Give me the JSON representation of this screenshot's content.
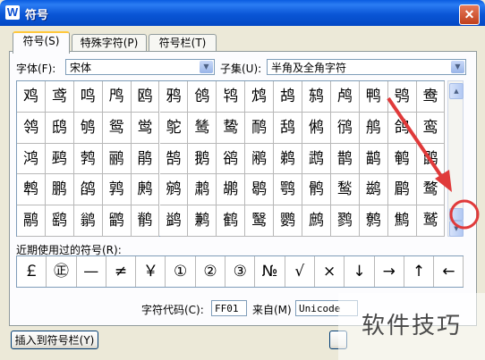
{
  "window": {
    "title": "符号",
    "close_glyph": "✕",
    "app_glyph": "W"
  },
  "tabs": [
    {
      "label": "符号(S)",
      "active": true
    },
    {
      "label": "特殊字符(P)",
      "active": false
    },
    {
      "label": "符号栏(T)",
      "active": false
    }
  ],
  "font": {
    "label": "字体(F):",
    "value": "宋体"
  },
  "subset": {
    "label": "子集(U):",
    "value": "半角及全角字符"
  },
  "grid_chars": [
    [
      "鸡",
      "鸢",
      "鸣",
      "鸤",
      "鸥",
      "鸦",
      "鸧",
      "鸨",
      "鸩",
      "鸪",
      "鸫",
      "鸬",
      "鸭",
      "鸮",
      "鸯"
    ],
    [
      "鸰",
      "鸱",
      "鸲",
      "鸳",
      "鸴",
      "鸵",
      "鸶",
      "鸷",
      "鸸",
      "鸹",
      "鸺",
      "鸻",
      "鸼",
      "鸽",
      "鸾"
    ],
    [
      "鸿",
      "鹀",
      "鹁",
      "鹂",
      "鹃",
      "鹄",
      "鹅",
      "鹆",
      "鹇",
      "鹈",
      "鹉",
      "鹊",
      "鹋",
      "鹌",
      "鹍"
    ],
    [
      "鹎",
      "鹏",
      "鹐",
      "鹑",
      "鹒",
      "鹓",
      "鹔",
      "鹕",
      "鹖",
      "鹗",
      "鹘",
      "鹙",
      "鹚",
      "鹛",
      "鹜"
    ],
    [
      "鹝",
      "鹞",
      "鹟",
      "鹠",
      "鹡",
      "鹢",
      "鹣",
      "鹤",
      "鹥",
      "鹦",
      "鹧",
      "鹨",
      "鹩",
      "鹪",
      "鹫"
    ]
  ],
  "recent": {
    "label": "近期使用过的符号(R):",
    "symbols": [
      "￡",
      "㊣",
      "—",
      "≠",
      "￥",
      "①",
      "②",
      "③",
      "№",
      "√",
      "×",
      "↓",
      "→",
      "↑",
      "←"
    ]
  },
  "char_code": {
    "label": "字符代码(C):",
    "value": "FF01"
  },
  "from": {
    "label": "来自(M)",
    "value": "Unicode"
  },
  "insert_button": "插入到符号栏(Y)",
  "watermark": "软件技巧",
  "scroll": {
    "up_glyph": "▲",
    "down_glyph": "▼",
    "combo_glyph": "▼"
  },
  "colors": {
    "annotation": "#e03a3a",
    "title_bar": "#0a56d6"
  }
}
